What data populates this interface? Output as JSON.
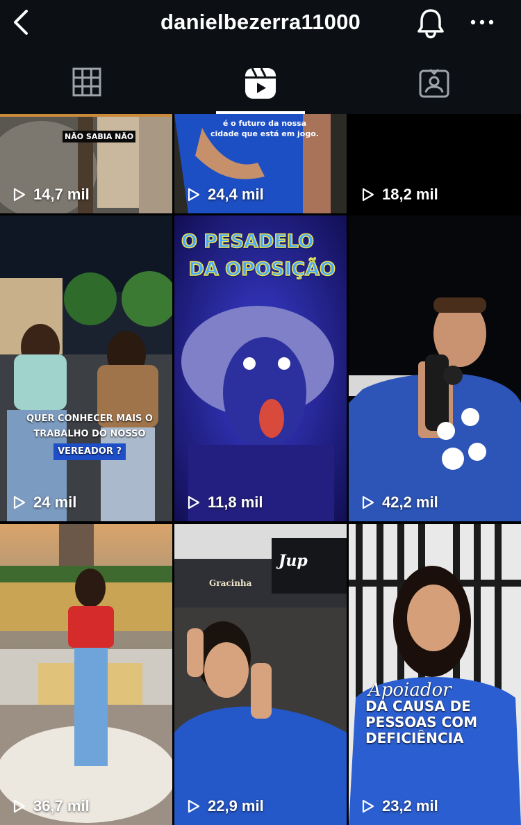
{
  "header": {
    "username": "danielbezerra11000"
  },
  "tiles": [
    {
      "views": "14,7 mil",
      "overlay": "NÃO SABIA NÃO"
    },
    {
      "views": "24,4 mil",
      "overlay": "é o futuro da nossa cidade que está em jogo."
    },
    {
      "views": "18,2 mil"
    },
    {
      "views": "24 mil",
      "overlay_lines": [
        "QUER CONHECER MAIS O",
        "TRABALHO DO NOSSO",
        "VEREADOR ?"
      ]
    },
    {
      "views": "11,8 mil",
      "overlay_lines": [
        "O PESADELO",
        "DA OPOSIÇÃO"
      ]
    },
    {
      "views": "42,2 mil"
    },
    {
      "views": "36,7 mil"
    },
    {
      "views": "22,9 mil",
      "signs": [
        "Jup",
        "Gracinha"
      ]
    },
    {
      "views": "23,2 mil",
      "overlay_lines": [
        "Apoiador",
        "DA CAUSA DE",
        "PESSOAS COM",
        "DEFICIÊNCIA"
      ]
    }
  ]
}
